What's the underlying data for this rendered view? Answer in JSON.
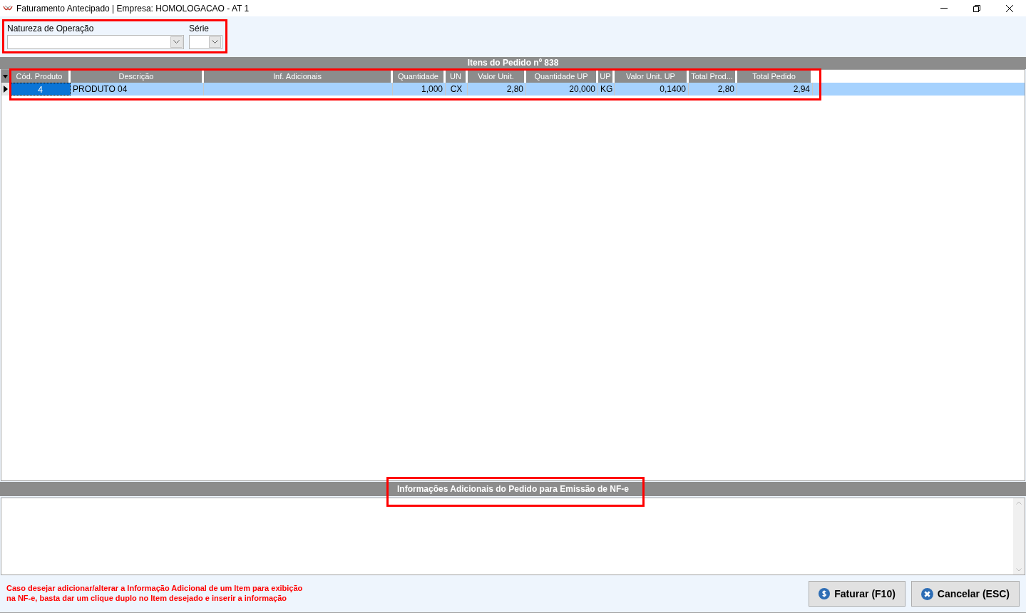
{
  "window": {
    "title": "Faturamento Antecipado | Empresa: HOMOLOGACAO - AT 1"
  },
  "fields": [
    {
      "label": "Natureza de Operação",
      "kind": "wide"
    },
    {
      "label": "Série",
      "kind": "narrow"
    }
  ],
  "grid": {
    "title": "Itens do Pedido nº 838",
    "columns": [
      {
        "label": "Cód. Produto"
      },
      {
        "label": "Descrição"
      },
      {
        "label": "Inf. Adicionais"
      },
      {
        "label": "Quantidade"
      },
      {
        "label": "UN"
      },
      {
        "label": "Valor Unit."
      },
      {
        "label": "Quantidade UP"
      },
      {
        "label": "UP"
      },
      {
        "label": "Valor Unit. UP"
      },
      {
        "label": "Total Prod..."
      },
      {
        "label": "Total Pedido"
      }
    ],
    "rows": [
      {
        "selected": true,
        "cells": [
          {
            "text": "4",
            "focused": true
          },
          {
            "text": "PRODUTO 04",
            "focused": false
          },
          {
            "focused": false
          },
          {
            "text": "1,000",
            "focused": false
          },
          {
            "text": "CX",
            "focused": false
          },
          {
            "text": "2,80",
            "focused": false
          },
          {
            "text": "20,000",
            "focused": false
          },
          {
            "text": "KG",
            "focused": false
          },
          {
            "text": "0,1400",
            "focused": false
          },
          {
            "text": "2,80",
            "focused": false
          },
          {
            "text": "2,94",
            "focused": false
          }
        ]
      }
    ]
  },
  "notes_section": {
    "title": "Informações Adicionais do Pedido para Emissão de NF-e"
  },
  "footer": {
    "hint": "Caso desejar adicionar/alterar a Informação Adicional de um Item para exibição na NF-e, basta dar um clique duplo no Item desejado e inserir a informação",
    "buttons": [
      {
        "label": "Faturar (F10)",
        "kind": "invoice"
      },
      {
        "label": "Cancelar (ESC)",
        "kind": "cancel"
      }
    ]
  }
}
